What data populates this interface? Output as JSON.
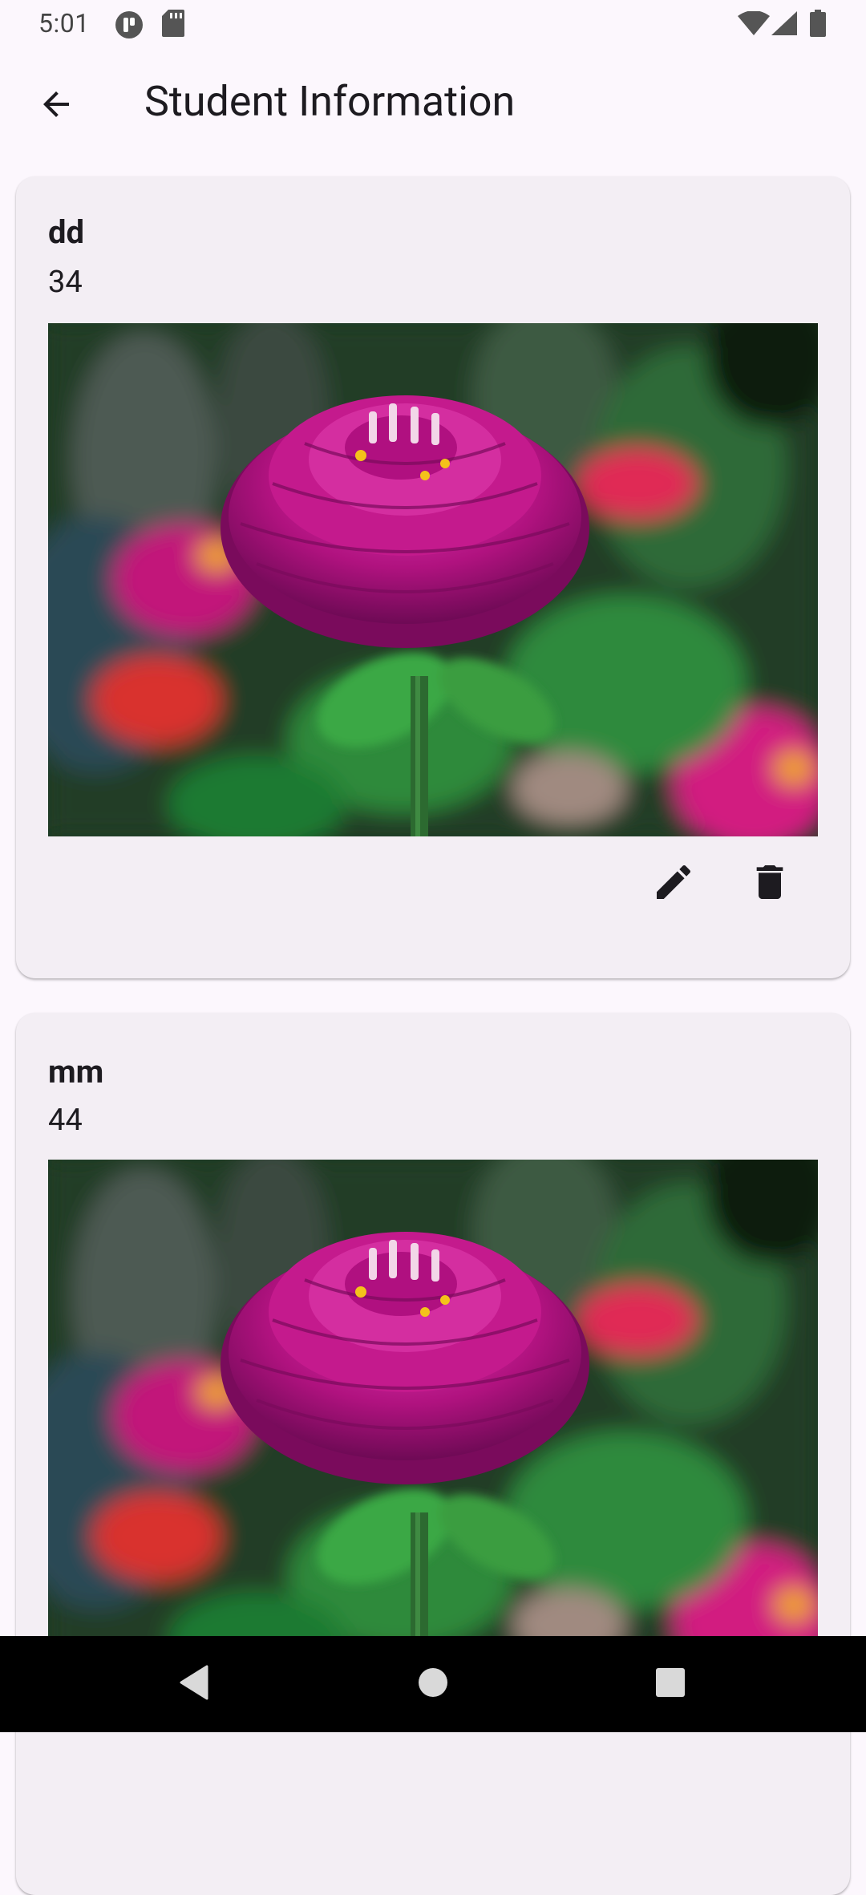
{
  "status_bar": {
    "time": "5:01"
  },
  "app_bar": {
    "title": "Student Information"
  },
  "students": [
    {
      "name": "dd",
      "age": "34"
    },
    {
      "name": "mm",
      "age": "44"
    }
  ],
  "icons": {
    "back": "arrow-back-icon",
    "edit": "pencil-icon",
    "delete": "trash-icon"
  },
  "colors": {
    "background": "#fcf7fd",
    "card": "#f3eef4",
    "flower": "#b0127f",
    "nav_bar": "#000000"
  }
}
